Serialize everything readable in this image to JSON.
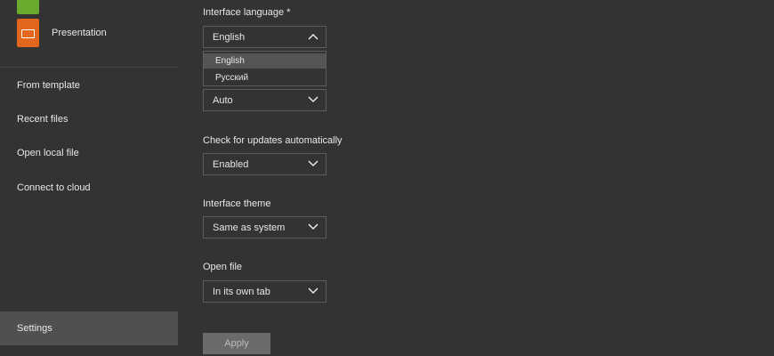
{
  "sidebar": {
    "documents": [
      {
        "label": "",
        "icon": "spreadsheet-icon",
        "color": "#6aaa2e"
      },
      {
        "label": "Presentation",
        "icon": "presentation-icon",
        "color": "#e2661c"
      }
    ],
    "nav": [
      {
        "label": "From template"
      },
      {
        "label": "Recent files"
      },
      {
        "label": "Open local file"
      },
      {
        "label": "Connect to cloud"
      },
      {
        "label": "Settings",
        "active": true
      }
    ]
  },
  "settings": {
    "language": {
      "label": "Interface language *",
      "value": "English",
      "options": [
        "English",
        "Русский"
      ]
    },
    "scaling": {
      "value": "Auto"
    },
    "updates": {
      "label": "Check for updates automatically",
      "value": "Enabled"
    },
    "theme": {
      "label": "Interface theme",
      "value": "Same as system"
    },
    "open_file": {
      "label": "Open file",
      "value": "In its own tab"
    },
    "apply_label": "Apply"
  },
  "colors": {
    "background": "#333333",
    "active_nav": "#505050",
    "spreadsheet": "#6aaa2e",
    "presentation": "#e2661c"
  }
}
